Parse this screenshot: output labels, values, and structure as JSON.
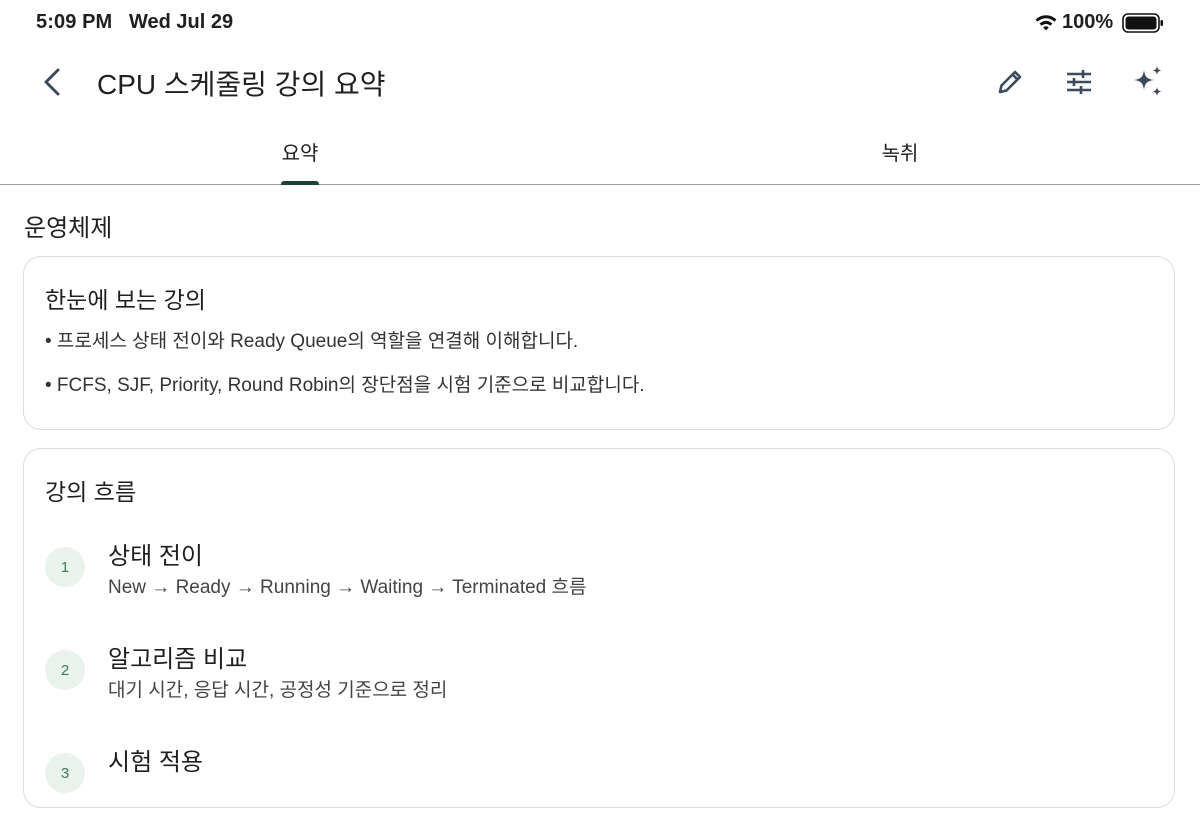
{
  "status_bar": {
    "time": "5:09 PM",
    "date": "Wed Jul 29",
    "battery": "100%",
    "icons": [
      "wifi-icon",
      "battery-icon"
    ]
  },
  "header": {
    "title": "CPU 스케줄링 강의 요약",
    "icons": [
      "back-icon",
      "pencil-icon",
      "tune-icon",
      "sparkle-icon"
    ]
  },
  "tabs": [
    {
      "label": "요약",
      "selected": true
    },
    {
      "label": "녹취",
      "selected": false
    }
  ],
  "section": {
    "label": "운영체제"
  },
  "summary_card": {
    "title": "한눈에 보는 강의",
    "bullets": [
      "• 프로세스 상태 전이와 Ready Queue의 역할을 연결해 이해합니다.",
      "• FCFS, SJF, Priority, Round Robin의 장단점을 시험 기준으로 비교합니다."
    ]
  },
  "flow_card": {
    "title": "강의 흐름",
    "steps": [
      {
        "number": "1",
        "title": "상태 전이",
        "desc": "New → Ready → Running → Waiting → Terminated 흐름"
      },
      {
        "number": "2",
        "title": "알고리즘 비교",
        "desc": "대기 시간, 응답 시간, 공정성 기준으로 정리"
      },
      {
        "number": "3",
        "title": "시험 적용",
        "desc": ""
      }
    ]
  },
  "colors": {
    "accent": "#1b4332",
    "badge_bg": "#e9f3ec",
    "badge_text": "#3e7a55",
    "icon": "#3c4a5c",
    "divider": "#9e9e9e",
    "card_border": "#dcdcdc"
  }
}
